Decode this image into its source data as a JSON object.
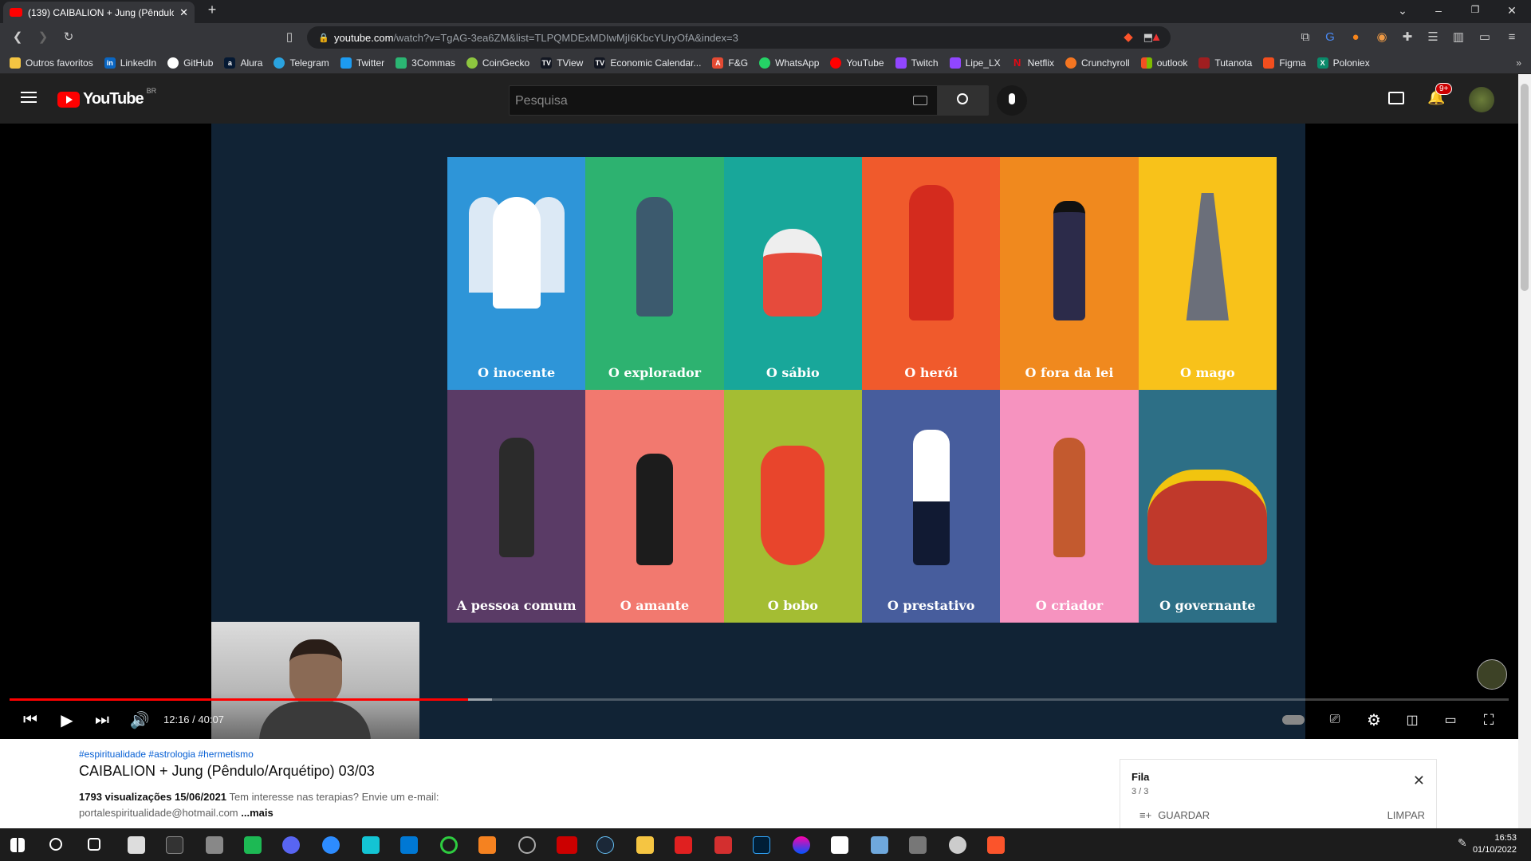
{
  "browser": {
    "tab_title": "(139) CAIBALION + Jung (Pêndulo",
    "url_domain": "youtube.com",
    "url_path": "/watch?v=TgAG-3ea6ZM&list=TLPQMDExMDIwMjI6KbcYUryOfA&index=3",
    "bookmarks": [
      "Outros favoritos",
      "LinkedIn",
      "GitHub",
      "Alura",
      "Telegram",
      "Twitter",
      "3Commas",
      "CoinGecko",
      "TView",
      "Economic Calendar...",
      "F&G",
      "WhatsApp",
      "YouTube",
      "Twitch",
      "Lipe_LX",
      "Netflix",
      "Crunchyroll",
      "outlook",
      "Tutanota",
      "Figma",
      "Poloniex"
    ],
    "bookmark_more": "»"
  },
  "youtube": {
    "logo_text": "YouTube",
    "region": "BR",
    "search_placeholder": "Pesquisa",
    "notif_count": "9+"
  },
  "slide": {
    "cards": [
      {
        "label": "O inocente",
        "color": "#2e95d8"
      },
      {
        "label": "O explorador",
        "color": "#2db270"
      },
      {
        "label": "O sábio",
        "color": "#18a79a"
      },
      {
        "label": "O herói",
        "color": "#f05a2c"
      },
      {
        "label": "O fora da lei",
        "color": "#f0891e"
      },
      {
        "label": "O mago",
        "color": "#f8c21a"
      },
      {
        "label": "A pessoa comum",
        "color": "#5a3b66"
      },
      {
        "label": "O amante",
        "color": "#f2796f"
      },
      {
        "label": "O bobo",
        "color": "#a4bd33"
      },
      {
        "label": "O prestativo",
        "color": "#475d9d"
      },
      {
        "label": "O criador",
        "color": "#f693bf"
      },
      {
        "label": "O governante",
        "color": "#2d6f86"
      }
    ]
  },
  "player": {
    "time": "12:16 / 40:07",
    "progress_fraction": 0.306,
    "buffer_fraction": 0.322
  },
  "video": {
    "tags": "#espiritualidade #astrologia #hermetismo",
    "title": "CAIBALION + Jung (Pêndulo/Arquétipo) 03/03",
    "views_date": "1793 visualizações  15/06/2021",
    "desc1": "Tem interesse nas terapias? Envie um e-mail:",
    "desc2": "portalespiritualidade@hotmail.com",
    "more": "...mais"
  },
  "queue": {
    "title": "Fila",
    "count": "3 / 3",
    "save": "GUARDAR",
    "clear": "LIMPAR"
  },
  "clock": {
    "time": "16:53",
    "date": "01/10/2022"
  }
}
